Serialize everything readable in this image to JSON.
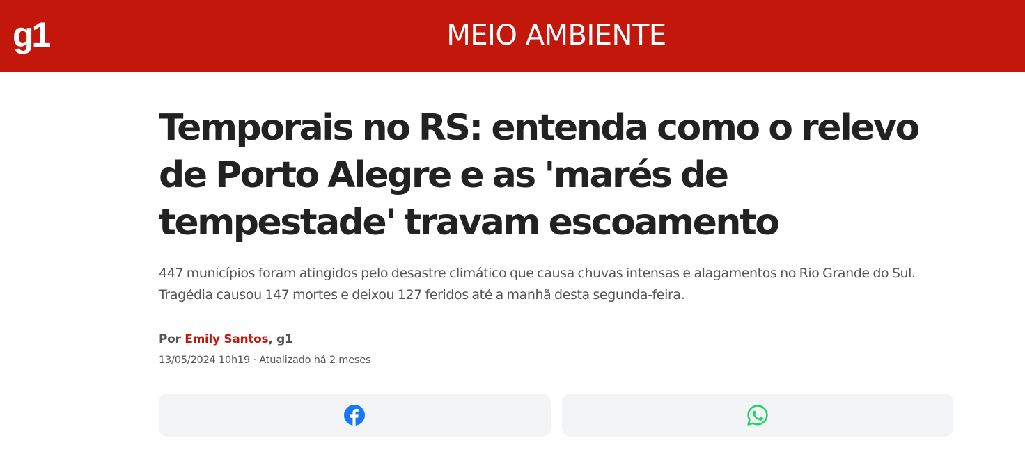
{
  "header": {
    "logo_text": "g1",
    "section": "MEIO AMBIENTE",
    "background_color": "#c4170c"
  },
  "article": {
    "headline": "Temporais no RS: entenda como o relevo de Porto Alegre e as 'marés de tempestade' travam escoamento",
    "subtitle": "447 municípios foram atingidos pelo desastre climático que causa chuvas intensas e alagamentos no Rio Grande do Sul. Tragédia causou 147 mortes e deixou 127 feridos até a manhã desta segunda-feira.",
    "byline": {
      "prefix": "Por",
      "author": "Emily Santos",
      "outlet": ", g1"
    },
    "dateline": "13/05/2024 10h19 · Atualizado há 2 meses"
  },
  "share": {
    "facebook_icon": "facebook-icon",
    "facebook_color": "#1877f2",
    "whatsapp_icon": "whatsapp-icon",
    "whatsapp_color": "#25d366"
  }
}
